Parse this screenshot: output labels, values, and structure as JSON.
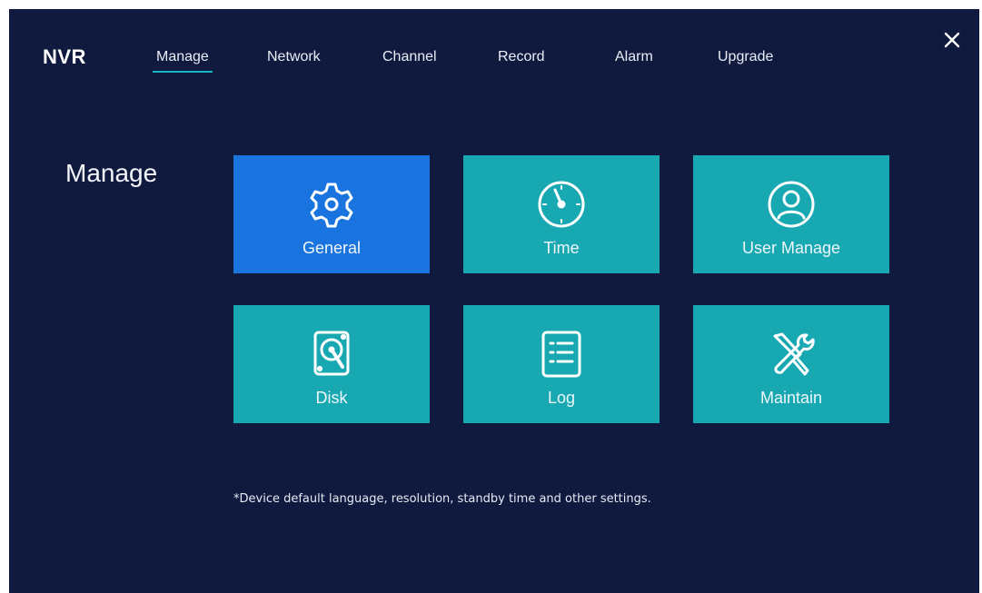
{
  "app": {
    "logo": "NVR"
  },
  "tabs": [
    {
      "label": "Manage",
      "active": true
    },
    {
      "label": "Network"
    },
    {
      "label": "Channel"
    },
    {
      "label": "Record"
    },
    {
      "label": "Alarm"
    },
    {
      "label": "Upgrade"
    }
  ],
  "section": {
    "title": "Manage"
  },
  "tiles": [
    {
      "label": "General",
      "icon": "gear-icon",
      "selected": true
    },
    {
      "label": "Time",
      "icon": "clock-icon"
    },
    {
      "label": "User Manage",
      "icon": "user-icon"
    },
    {
      "label": "Disk",
      "icon": "hard-disk-icon"
    },
    {
      "label": "Log",
      "icon": "log-list-icon"
    },
    {
      "label": "Maintain",
      "icon": "wrench-screwdriver-icon"
    }
  ],
  "note": {
    "text": "*Device default language, resolution, standby time and other settings."
  },
  "colors": {
    "background": "#0f1a3e",
    "tile": "#17a8b2",
    "tile_selected": "#1a74e0",
    "tab_underline": "#19b5c2"
  }
}
